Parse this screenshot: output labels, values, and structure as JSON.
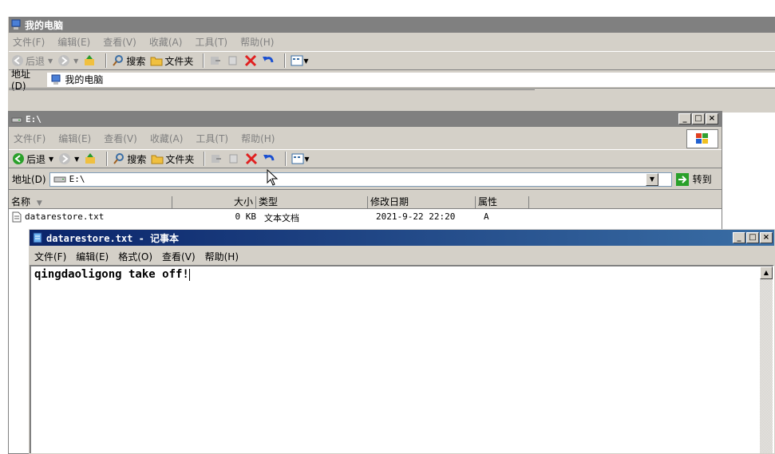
{
  "back_window": {
    "title": "我的电脑",
    "menu": [
      "文件(F)",
      "编辑(E)",
      "查看(V)",
      "收藏(A)",
      "工具(T)",
      "帮助(H)"
    ],
    "toolbar": {
      "back": "后退",
      "search": "搜索",
      "folders": "文件夹"
    },
    "address_label": "地址(D)",
    "address_value": "我的电脑"
  },
  "explorer": {
    "title": "E:\\",
    "menu": [
      "文件(F)",
      "编辑(E)",
      "查看(V)",
      "收藏(A)",
      "工具(T)",
      "帮助(H)"
    ],
    "toolbar": {
      "back": "后退",
      "search": "搜索",
      "folders": "文件夹"
    },
    "address_label": "地址(D)",
    "address_value": "E:\\",
    "go_label": "转到",
    "columns": [
      "名称",
      "大小",
      "类型",
      "修改日期",
      "属性"
    ],
    "files": [
      {
        "name": "datarestore.txt",
        "size": "0 KB",
        "type": "文本文档",
        "modified": "2021-9-22 22:20",
        "attr": "A"
      }
    ]
  },
  "notepad": {
    "title": "datarestore.txt - 记事本",
    "menu": [
      "文件(F)",
      "编辑(E)",
      "格式(O)",
      "查看(V)",
      "帮助(H)"
    ],
    "content": "qingdaoligong take off!"
  },
  "icons": {
    "computer": "my-computer-icon",
    "drive": "drive-icon",
    "file": "text-file-icon",
    "back": "back-arrow-icon",
    "forward": "forward-arrow-icon",
    "up": "up-folder-icon",
    "search": "search-icon",
    "folders": "folders-icon",
    "delete": "delete-x-icon",
    "undo": "undo-icon",
    "views": "views-icon",
    "go": "go-arrow-icon",
    "windows_logo": "windows-logo-icon"
  },
  "colors": {
    "active_title": "#0a246a",
    "inactive_title": "#808080",
    "delete_red": "#e02020",
    "undo_blue": "#1a4fd0",
    "go_green": "#2aa02a"
  }
}
